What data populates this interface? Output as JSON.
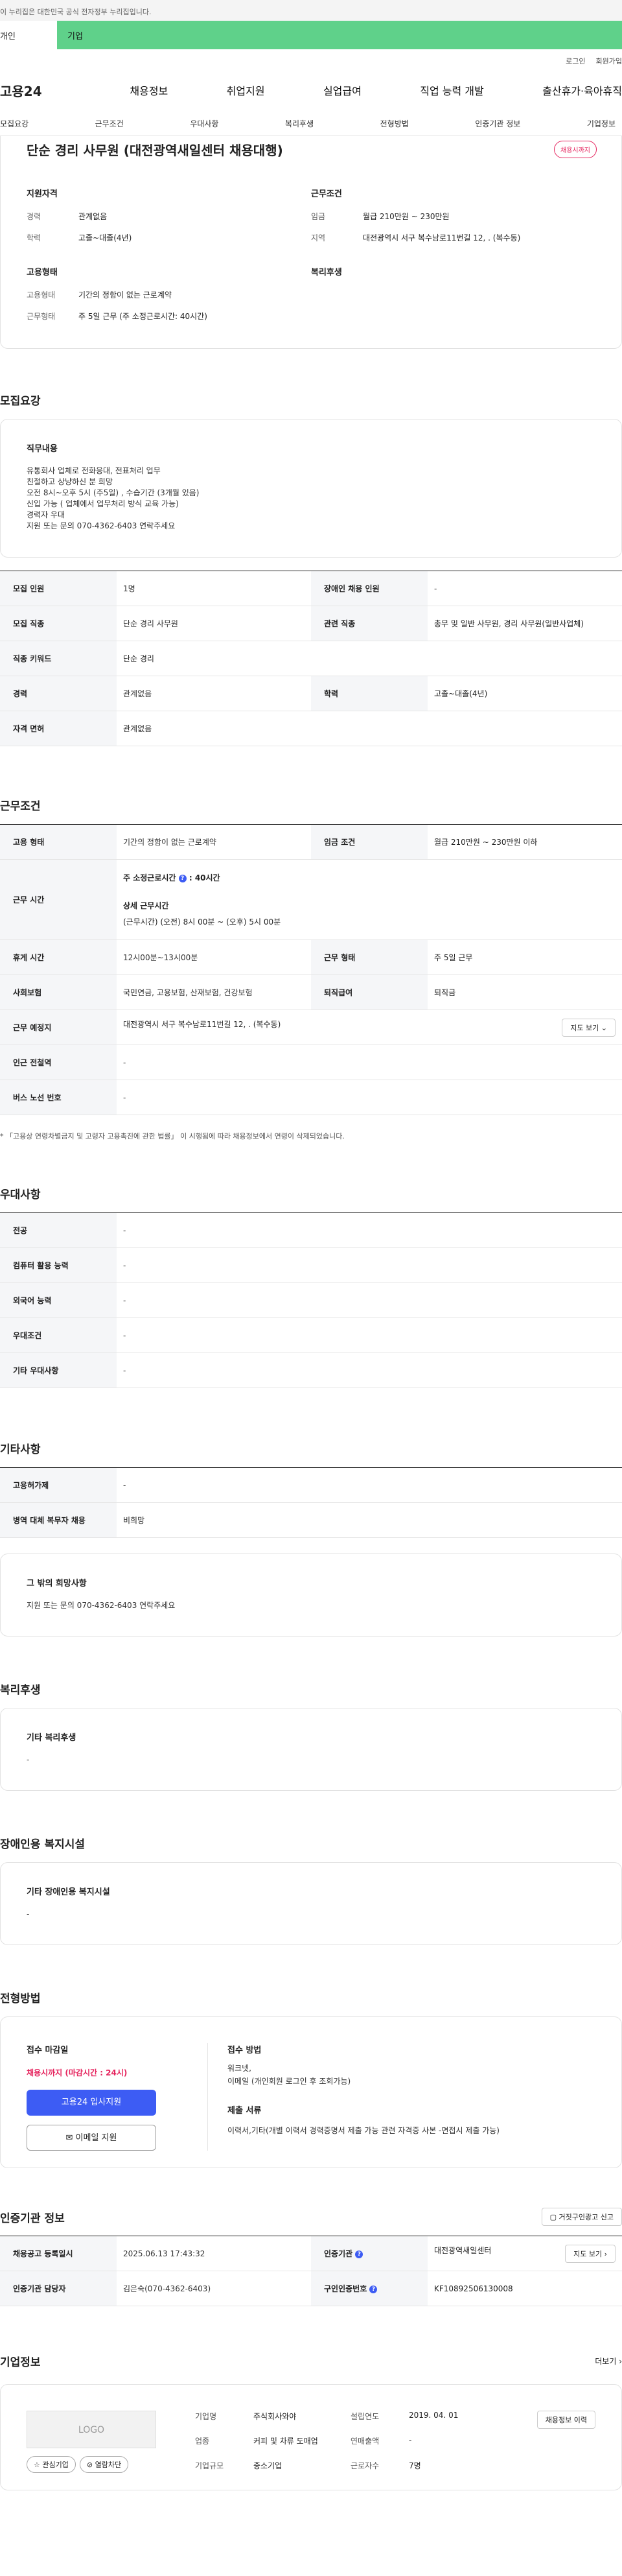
{
  "gov_banner": "이 누리집은 대한민국 공식 전자정부 누리집입니다.",
  "topbar": {
    "left": "개인",
    "right": "기업"
  },
  "util": {
    "login": "로그인",
    "join": "회원가입"
  },
  "gnb": {
    "logo": "고용24",
    "menu": [
      "채용정보",
      "취업지원",
      "실업급여",
      "직업 능력 개발",
      "출산휴가·육아휴직"
    ]
  },
  "subnav": [
    "모집요강",
    "근무조건",
    "우대사항",
    "복리후생",
    "전형방법",
    "인증기관 정보",
    "기업정보"
  ],
  "summary": {
    "title": "단순 경리 사무원 (대전광역새일센터 채용대행)",
    "status": "채용시까지",
    "qual_head": "지원자격",
    "qual": [
      {
        "k": "경력",
        "v": "관계없음"
      },
      {
        "k": "학력",
        "v": "고졸~대졸(4년)"
      }
    ],
    "cond_head": "근무조건",
    "cond": [
      {
        "k": "임금",
        "v": "월급 210만원 ~ 230만원"
      },
      {
        "k": "지역",
        "v": "대전광역시 서구 복수남로11번길 12, . (복수동)"
      }
    ],
    "emp_head": "고용형태",
    "emp": [
      {
        "k": "고용형태",
        "v": "기간의 정함이 없는 근로계약"
      },
      {
        "k": "근무형태",
        "v": "주 5일 근무 (주 소정근로시간: 40시간)"
      }
    ],
    "welfare_head": "복리후생"
  },
  "recruit": {
    "title": "모집요강",
    "desc_head": "직무내용",
    "desc": "유통회사  업체로  전화응대, 전표처리 업무\n 친절하고 상냥하신 분 희망\n 오전 8시~오후 5시 (주5일) , 수습기간 (3개월 있음)\n신입 가능 ( 업체에서  업무처리 방식 교육 가능)\n경력자 우대\n 지원 또는 문의  070-4362-6403   연락주세요",
    "rows": [
      [
        "모집 인원",
        "1명",
        "장애인 채용 인원",
        "-"
      ],
      [
        "모집 직종",
        "단순 경리 사무원",
        "관련 직종",
        "총무 및 일반 사무원, 경리 사무원(일반사업체)"
      ],
      [
        "직종 키워드",
        "단순 경리",
        "",
        ""
      ],
      [
        "경력",
        "관계없음",
        "학력",
        "고졸~대졸(4년)"
      ],
      [
        "자격 면허",
        "관계없음",
        "",
        ""
      ]
    ]
  },
  "work": {
    "title": "근무조건",
    "r1": [
      "고용 형태",
      "기간의 정함이 없는 근로계약",
      "임금 조건",
      "월급 210만원 ~ 230만원 이하"
    ],
    "hours_label": "근무 시간",
    "hours_main": "주 소정근로시간",
    "hours_main_v": ": 40시간",
    "hours_detail_head": "상세 근무시간",
    "hours_detail": "(근무시간) (오전) 8시 00분 ~ (오후) 5시 00분",
    "r3": [
      "휴게 시간",
      "12시00분~13시00분",
      "근무 형태",
      "주 5일 근무"
    ],
    "r4": [
      "사회보험",
      "국민연금, 고용보험, 산재보험, 건강보험",
      "퇴직급여",
      "퇴직금"
    ],
    "r5": [
      "근무 예정지",
      "대전광역시 서구 복수남로11번길 12, . (복수동)"
    ],
    "map_btn": "지도 보기",
    "r6": [
      "인근 전철역",
      "-"
    ],
    "r7": [
      "버스 노선 번호",
      "-"
    ],
    "note": "* 「고용상 연령차별금지 및 고령자 고용촉진에 관한 법률」 이 시행됨에 따라 채용정보에서 연령이 삭제되었습니다."
  },
  "pref": {
    "title": "우대사항",
    "rows": [
      [
        "전공",
        "-"
      ],
      [
        "컴퓨터 활용 능력",
        "-"
      ],
      [
        "외국어 능력",
        "-"
      ],
      [
        "우대조건",
        "-"
      ],
      [
        "기타 우대사항",
        "-"
      ]
    ]
  },
  "other": {
    "title": "기타사항",
    "rows": [
      [
        "고용허가제",
        "-"
      ],
      [
        "병역 대체 복무자 채용",
        "비희망"
      ]
    ],
    "box_head": "그 밖의 희망사항",
    "box_text": "지원 또는 문의 070-4362-6403 연락주세요"
  },
  "welfare": {
    "title": "복리후생",
    "head": "기타 복리후생",
    "text": "-"
  },
  "disab": {
    "title": "장애인용 복지시설",
    "head": "기타 장애인용 복지시설",
    "text": "-"
  },
  "process": {
    "title": "전형방법",
    "deadline_head": "접수 마감일",
    "deadline": "채용시까지 (마감시간 : 24시)",
    "apply_btn": "고용24 입사지원",
    "email_btn": "이메일 지원",
    "method_head": "접수 방법",
    "method": "워크넷,\n이메일 (개인회원 로그인 후 조회가능)",
    "docs_head": "제출 서류",
    "docs": "이력서,기타(개별 이력서 경력증명서 제출 가능 관련 자격증 사본 -면접시 제출 가능)"
  },
  "agency": {
    "title": "인증기관 정보",
    "report_btn": "거짓구인광고 신고",
    "r1": [
      "채용공고 등록일시",
      "2025.06.13 17:43:32",
      "인증기관",
      "대전광역새일센터"
    ],
    "map_btn": "지도 보기",
    "r2": [
      "인증기관 담당자",
      "김은숙(070-4362-6403)",
      "구인인증번호",
      "KF10892506130008"
    ]
  },
  "company": {
    "title": "기업정보",
    "more": "더보기",
    "logo": "LOGO",
    "fav": "관심기업",
    "block": "열람차단",
    "k1": "기업명",
    "v1": "주식회사와야",
    "k2": "설립연도",
    "v2": "2019. 04. 01",
    "k3": "업종",
    "v3": "커피 및 차류 도매업",
    "k4": "연매출액",
    "v4": "-",
    "k5": "기업규모",
    "v5": "중소기업",
    "k6": "근로자수",
    "v6": "7명",
    "btn": "채용정보 이력"
  }
}
